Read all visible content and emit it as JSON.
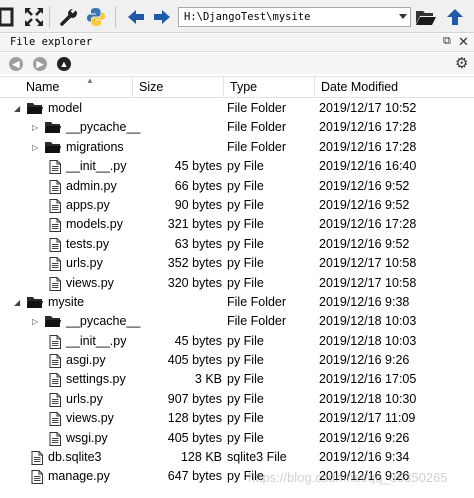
{
  "toolbar": {
    "path": "H:\\DjangoTest\\mysite"
  },
  "explorer": {
    "title": "File explorer",
    "columns": {
      "name": "Name",
      "size": "Size",
      "type": "Type",
      "date": "Date Modified"
    },
    "rows": [
      {
        "name": "model",
        "size": "",
        "type": "File Folder",
        "date": "2019/12/17 10:52",
        "kind": "folder",
        "level": 0,
        "expanded": true
      },
      {
        "name": "__pycache__",
        "size": "",
        "type": "File Folder",
        "date": "2019/12/16 17:28",
        "kind": "folder",
        "level": 1,
        "expanded": false
      },
      {
        "name": "migrations",
        "size": "",
        "type": "File Folder",
        "date": "2019/12/16 17:28",
        "kind": "folder",
        "level": 1,
        "expanded": false
      },
      {
        "name": "__init__.py",
        "size": "45 bytes",
        "type": "py File",
        "date": "2019/12/16 16:40",
        "kind": "file",
        "level": 1
      },
      {
        "name": "admin.py",
        "size": "66 bytes",
        "type": "py File",
        "date": "2019/12/16 9:52",
        "kind": "file",
        "level": 1
      },
      {
        "name": "apps.py",
        "size": "90 bytes",
        "type": "py File",
        "date": "2019/12/16 9:52",
        "kind": "file",
        "level": 1
      },
      {
        "name": "models.py",
        "size": "321 bytes",
        "type": "py File",
        "date": "2019/12/16 17:28",
        "kind": "file",
        "level": 1
      },
      {
        "name": "tests.py",
        "size": "63 bytes",
        "type": "py File",
        "date": "2019/12/16 9:52",
        "kind": "file",
        "level": 1
      },
      {
        "name": "urls.py",
        "size": "352 bytes",
        "type": "py File",
        "date": "2019/12/17 10:58",
        "kind": "file",
        "level": 1
      },
      {
        "name": "views.py",
        "size": "320 bytes",
        "type": "py File",
        "date": "2019/12/17 10:58",
        "kind": "file",
        "level": 1
      },
      {
        "name": "mysite",
        "size": "",
        "type": "File Folder",
        "date": "2019/12/16 9:38",
        "kind": "folder",
        "level": 0,
        "expanded": true
      },
      {
        "name": "__pycache__",
        "size": "",
        "type": "File Folder",
        "date": "2019/12/18 10:03",
        "kind": "folder",
        "level": 1,
        "expanded": false
      },
      {
        "name": "__init__.py",
        "size": "45 bytes",
        "type": "py File",
        "date": "2019/12/18 10:03",
        "kind": "file",
        "level": 1
      },
      {
        "name": "asgi.py",
        "size": "405 bytes",
        "type": "py File",
        "date": "2019/12/16 9:26",
        "kind": "file",
        "level": 1
      },
      {
        "name": "settings.py",
        "size": "3 KB",
        "type": "py File",
        "date": "2019/12/16 17:05",
        "kind": "file",
        "level": 1
      },
      {
        "name": "urls.py",
        "size": "907 bytes",
        "type": "py File",
        "date": "2019/12/18 10:30",
        "kind": "file",
        "level": 1
      },
      {
        "name": "views.py",
        "size": "128 bytes",
        "type": "py File",
        "date": "2019/12/17 11:09",
        "kind": "file",
        "level": 1
      },
      {
        "name": "wsgi.py",
        "size": "405 bytes",
        "type": "py File",
        "date": "2019/12/16 9:26",
        "kind": "file",
        "level": 1
      },
      {
        "name": "db.sqlite3",
        "size": "128 KB",
        "type": "sqlite3 File",
        "date": "2019/12/16 9:34",
        "kind": "file",
        "level": 0
      },
      {
        "name": "manage.py",
        "size": "647 bytes",
        "type": "py File",
        "date": "2019/12/16 9:26",
        "kind": "file",
        "level": 0
      }
    ]
  },
  "watermark": "https://blog.csdn.net/qq_36350265",
  "colors": {
    "nav_back": "#9e9e9e",
    "nav_forward": "#9e9e9e",
    "nav_up": "#222222",
    "arrow_blue": "#1e5aa8",
    "python_blue": "#3b76b0",
    "python_yellow": "#f7c93e"
  }
}
